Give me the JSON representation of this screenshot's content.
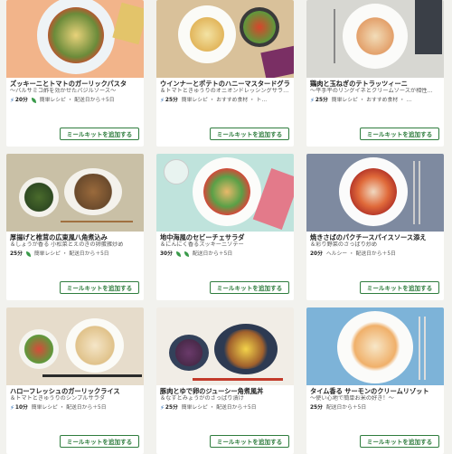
{
  "recipes": [
    {
      "title": "ズッキーニとトマトのガーリックパスタ",
      "subtitle": "～バルサミコ酢を効かせたバジルソース～",
      "time": "20分",
      "speed_icon": true,
      "tags": "簡単レシピ ・ 配送日から＋5日",
      "button": "ミールキットを追加する",
      "bg": "#f2b48a"
    },
    {
      "title": "ウインナーとポテトのハニーマスタードグラ…",
      "subtitle": "＆トマトときゅうりのオニオンドレッシングサラ…",
      "time": "25分",
      "speed_icon": true,
      "tags": "簡単レシピ ・ おすすめ食材 ・ ト…",
      "button": "ミールキットを追加する",
      "bg": "#d9c19a"
    },
    {
      "title": "鶏肉と玉ねぎのテトラッツィーニ",
      "subtitle": "～平手平のリングイネとクリームソースが相性…",
      "time": "25分",
      "speed_icon": true,
      "tags": "簡単レシピ ・ おすすめ食材 ・ …",
      "button": "ミールキットを追加する",
      "bg": "#d7d7d2"
    },
    {
      "title": "厚揚げと椎茸の広東風八角煮込み",
      "subtitle": "＆しょうが香る 小松菜とえのきの卵蛋雑炒め",
      "time": "25分",
      "speed_icon": false,
      "tags": "簡単レシピ ・ 配送日から＋5日",
      "button": "ミールキットを追加する",
      "bg": "#c9c0a6"
    },
    {
      "title": "地中海風のセビーチェサラダ",
      "subtitle": "＆にんにく香るズッキーニソテー",
      "time": "30分",
      "speed_icon": false,
      "tags": "配送日から＋5日",
      "button": "ミールキットを追加する",
      "bg": "#bfe3dc"
    },
    {
      "title": "焼きさばのパクチースパイスソース添え",
      "subtitle": "＆彩り野菜のさっぱり炒め",
      "time": "20分",
      "speed_icon": false,
      "tags": "ヘルシー ・ 配送日から＋5日",
      "button": "ミールキットを追加する",
      "bg": "#7e8aa0"
    },
    {
      "title": "ハローフレッシュのガーリックライス",
      "subtitle": "＆トマトときゅうりのシンプルサラダ",
      "time": "10分",
      "speed_icon": true,
      "tags": "簡単レシピ ・ 配送日から＋5日",
      "button": "ミールキットを追加する",
      "bg": "#e6dccb"
    },
    {
      "title": "豚肉とゆで卵のジューシー角煮風丼",
      "subtitle": "＆なすとみょうがのさっぱり漬け",
      "time": "25分",
      "speed_icon": true,
      "tags": "簡単レシピ ・ 配送日から＋5日",
      "button": "ミールキットを追加する",
      "bg": "#f1ede6"
    },
    {
      "title": "タイム香る サーモンのクリームリゾット",
      "subtitle": "～使い心地で簡単お米の好き！～",
      "time": "25分",
      "speed_icon": false,
      "tags": "配送日から＋5日",
      "button": "ミールキットを追加する",
      "bg": "#7db3d8"
    }
  ]
}
